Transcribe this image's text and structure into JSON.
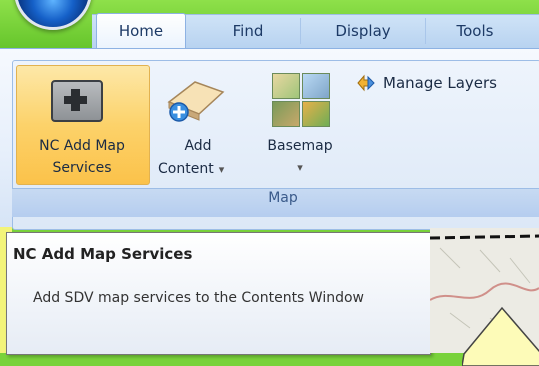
{
  "tabs": [
    {
      "label": "Home",
      "active": true
    },
    {
      "label": "Find",
      "active": false
    },
    {
      "label": "Display",
      "active": false
    },
    {
      "label": "Tools",
      "active": false
    }
  ],
  "ribbon": {
    "nc_add": {
      "line1": "NC Add Map",
      "line2": "Services",
      "icon": "add-service-icon"
    },
    "add_content": {
      "line1": "Add",
      "line2": "Content",
      "dropdown": "▾",
      "icon": "add-content-icon"
    },
    "basemap": {
      "line1": "Basemap",
      "dropdown": "▾",
      "icon": "basemap-icon"
    },
    "manage_layers": {
      "label": "Manage Layers",
      "icon": "manage-layers-icon"
    },
    "group_label": "Map"
  },
  "tooltip": {
    "title": "NC Add Map Services",
    "body": "Add SDV map services to the Contents Window"
  },
  "colors": {
    "background": "#79d23b",
    "highlight": "#fcd26a",
    "ribbon": "#dce8f7",
    "callout": "#fdfbb8"
  }
}
